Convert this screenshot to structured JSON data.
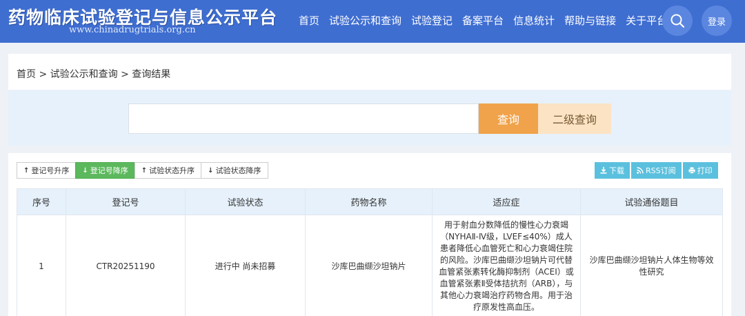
{
  "header": {
    "title": "药物临床试验登记与信息公示平台",
    "url": "www.chinadrugtrials.org.cn",
    "nav": [
      "首页",
      "试验公示和查询",
      "试验登记",
      "备案平台",
      "信息统计",
      "帮助与链接",
      "关于平台"
    ],
    "login_label": "登录"
  },
  "breadcrumb": "首页 > 试验公示和查询 > 查询结果",
  "search": {
    "value": "",
    "search_label": "查询",
    "advanced_label": "二级查询"
  },
  "sort_buttons": [
    {
      "label": "登记号升序",
      "arrow": "↑",
      "active": false
    },
    {
      "label": "登记号降序",
      "arrow": "↓",
      "active": true
    },
    {
      "label": "试验状态升序",
      "arrow": "↑",
      "active": false
    },
    {
      "label": "试验状态降序",
      "arrow": "↓",
      "active": false
    }
  ],
  "actions": [
    {
      "label": "下载",
      "icon": "download-icon"
    },
    {
      "label": "RSS订阅",
      "icon": "rss-icon"
    },
    {
      "label": "打印",
      "icon": "print-icon"
    }
  ],
  "table": {
    "headers": [
      "序号",
      "登记号",
      "试验状态",
      "药物名称",
      "适应症",
      "试验通俗题目"
    ],
    "rows": [
      {
        "index": "1",
        "reg_no": "CTR20251190",
        "status": "进行中 尚未招募",
        "drug": "沙库巴曲缬沙坦钠片",
        "indication": "用于射血分数降低的慢性心力衰竭（NYHAⅡ-Ⅳ级，LVEF≤40%）成人患者降低心血管死亡和心力衰竭住院的风险。沙库巴曲缬沙坦钠片可代替血管紧张素转化酶抑制剂（ACEI）或血管紧张素Ⅱ受体拮抗剂（ARB），与其他心力衰竭治疗药物合用。用于治疗原发性高血压。",
        "title": "沙库巴曲缬沙坦钠片人体生物等效性研究"
      }
    ]
  }
}
